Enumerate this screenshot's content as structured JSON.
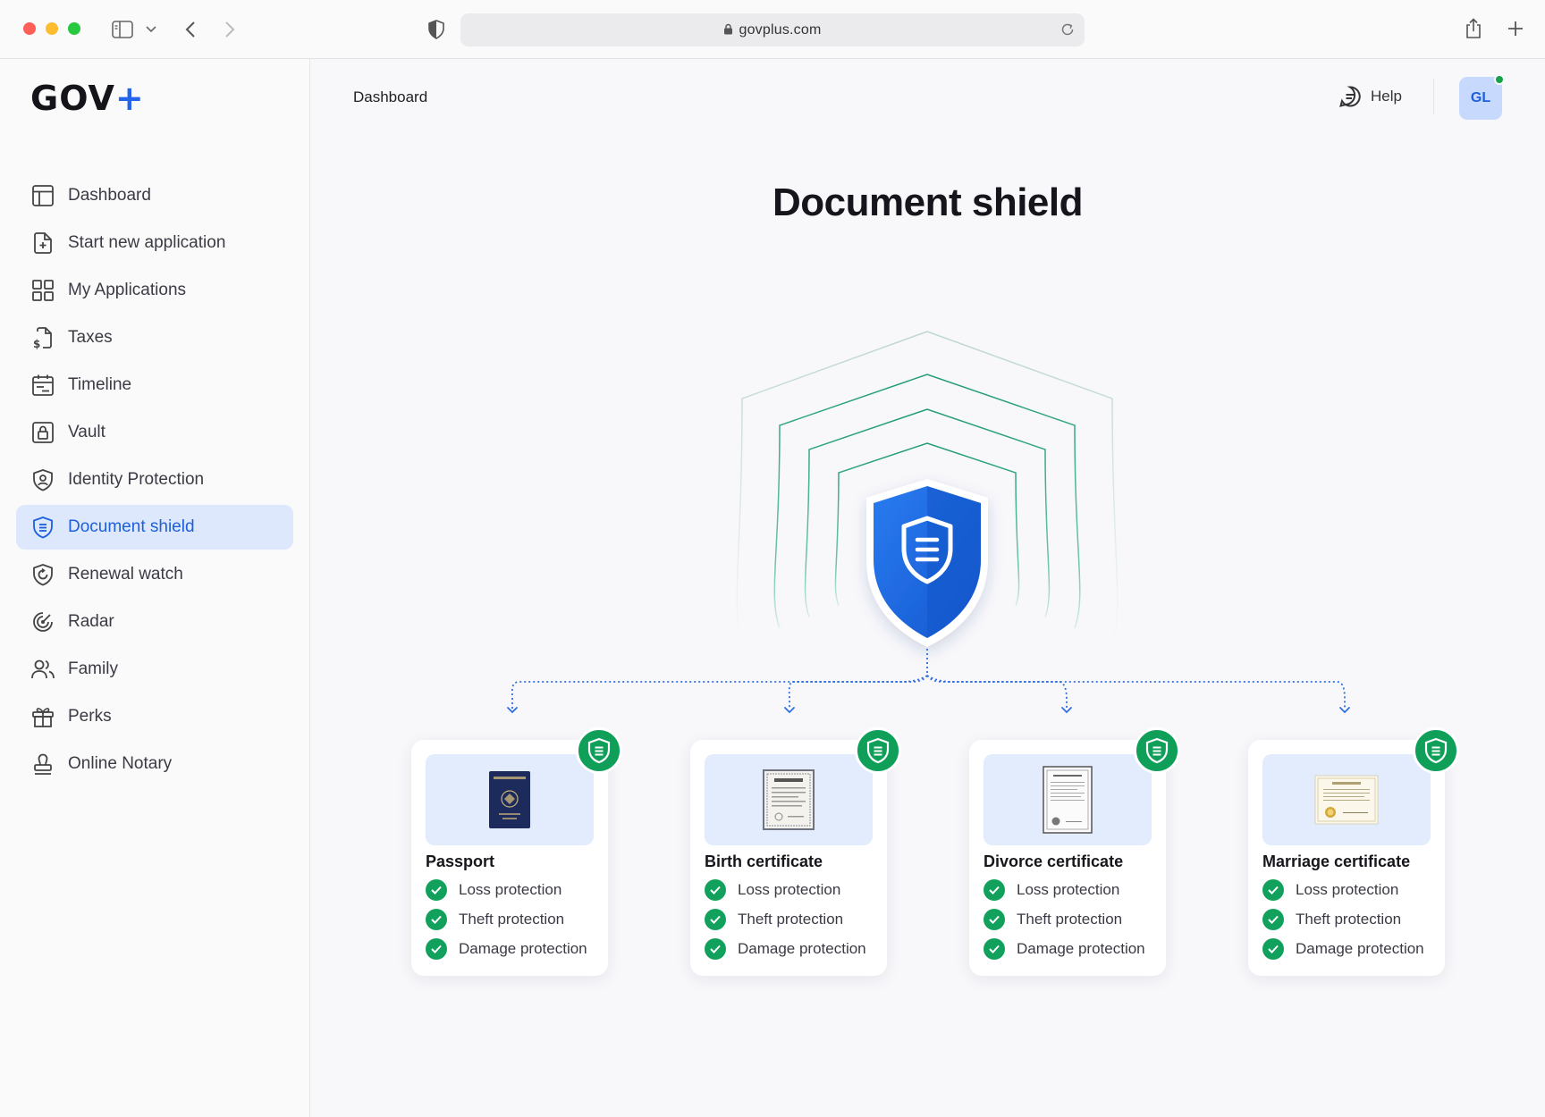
{
  "browser": {
    "url": "govplus.com"
  },
  "sidebar": {
    "logo_text": "GOV",
    "logo_plus": "+",
    "items": [
      {
        "label": "Dashboard",
        "icon": "layout-icon"
      },
      {
        "label": "Start new application",
        "icon": "file-plus-icon"
      },
      {
        "label": "My Applications",
        "icon": "grid-icon"
      },
      {
        "label": "Taxes",
        "icon": "file-dollar-icon"
      },
      {
        "label": "Timeline",
        "icon": "calendar-icon"
      },
      {
        "label": "Vault",
        "icon": "lock-icon"
      },
      {
        "label": "Identity Protection",
        "icon": "shield-user-icon"
      },
      {
        "label": "Document shield",
        "icon": "shield-doc-icon",
        "active": true
      },
      {
        "label": "Renewal watch",
        "icon": "shield-refresh-icon"
      },
      {
        "label": "Radar",
        "icon": "radar-icon"
      },
      {
        "label": "Family",
        "icon": "users-icon"
      },
      {
        "label": "Perks",
        "icon": "gift-icon"
      },
      {
        "label": "Online Notary",
        "icon": "stamp-icon"
      }
    ]
  },
  "header": {
    "breadcrumb": "Dashboard",
    "help_label": "Help",
    "avatar_initials": "GL"
  },
  "page": {
    "title": "Document shield"
  },
  "documents": [
    {
      "name": "Passport",
      "features": [
        "Loss protection",
        "Theft protection",
        "Damage protection"
      ]
    },
    {
      "name": "Birth certificate",
      "features": [
        "Loss protection",
        "Theft protection",
        "Damage protection"
      ]
    },
    {
      "name": "Divorce certificate",
      "features": [
        "Loss protection",
        "Theft protection",
        "Damage protection"
      ]
    },
    {
      "name": "Marriage certificate",
      "features": [
        "Loss protection",
        "Theft protection",
        "Damage protection"
      ]
    }
  ],
  "colors": {
    "accent": "#2563eb",
    "active_bg": "#dde8fd",
    "success": "#12a15c",
    "shield_blue": "#1d6fe8"
  }
}
